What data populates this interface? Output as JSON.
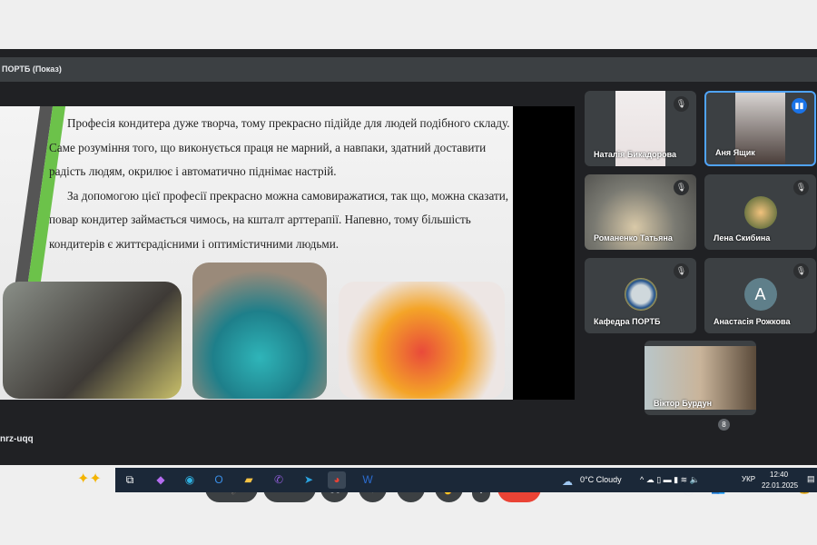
{
  "window": {
    "title": "ПОРТБ (Показ)",
    "meeting_code": "nrz-uqq"
  },
  "slide": {
    "paragraphs": [
      "Професія кондитера дуже творча, тому прекрасно підійде для людей подібного складу. Саме розуміння того, що виконується праця не марний, а навпаки, здатний доставити радість людям, окрилює і автоматично піднімає настрій.",
      "За допомогою цієї професії прекрасно можна самовиражатися, так що, можна сказати, повар кондитер займається чимось, на кшталт арттерапії. Напевно, тому більшість кондитерів є життєрадісними і оптимістичними людьми."
    ]
  },
  "participants": [
    {
      "name": "Наталія Бикадорова",
      "muted": true
    },
    {
      "name": "Аня Ящик",
      "speaking": true
    },
    {
      "name": "Романенко Татьяна",
      "muted": true
    },
    {
      "name": "Лена Скибина",
      "muted": true
    },
    {
      "name": "Кафедра ПОРТБ",
      "muted": true
    },
    {
      "name": "Анастасія Рожкова",
      "muted": true,
      "initial": "A"
    },
    {
      "name": "Віктор Бурдун"
    }
  ],
  "toolbar": {
    "people_count": "8"
  },
  "taskbar": {
    "weather": "0°C  Cloudy",
    "language": "УКР",
    "time": "12:40",
    "date": "22.01.2025"
  },
  "colors": {
    "end_call": "#ea4335",
    "speaking": "#1a73e8"
  }
}
